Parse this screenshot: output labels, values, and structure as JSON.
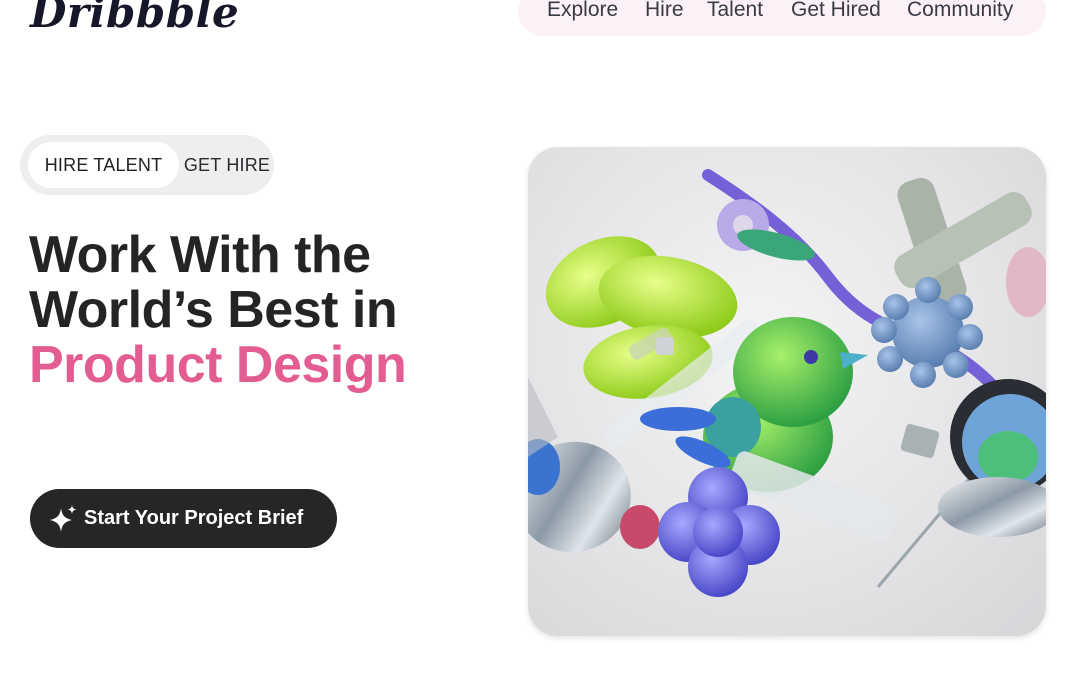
{
  "brand": {
    "logo_text": "Dribbble"
  },
  "nav": {
    "items": [
      "Explore",
      "Hire",
      "Talent",
      "Get Hired",
      "Community"
    ]
  },
  "toggle": {
    "active_label": "HIRE TALENT",
    "inactive_label": "GET HIRE"
  },
  "hero": {
    "headline_line1": "Work With the",
    "headline_line2": "World’s Best in",
    "headline_accent": "Product Design",
    "cta_label": "Start Your Project Brief",
    "image_description": "3D render of colorful abstract shapes: green inflatable bird, lime textured coil, purple ribbon, blue spiky ball, grey cross, purple clover"
  },
  "colors": {
    "accent": "#e35d92",
    "cta_bg": "#262626",
    "nav_bg": "#fcf1f7",
    "toggle_bg": "#eeeeee"
  }
}
